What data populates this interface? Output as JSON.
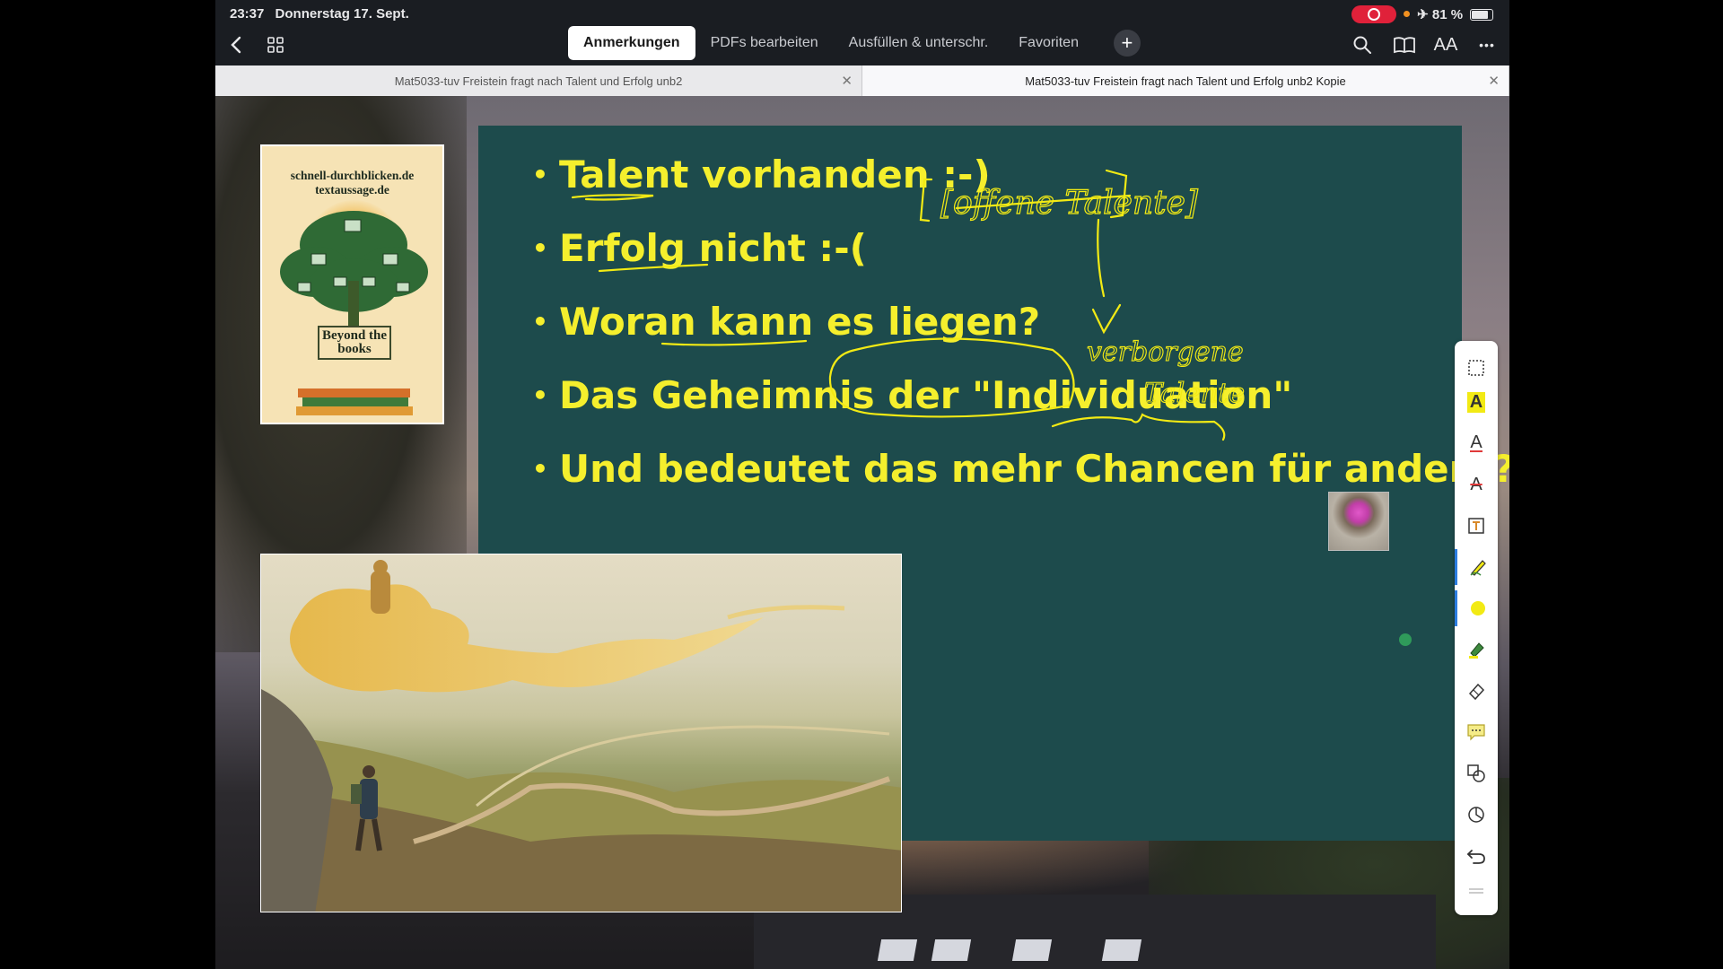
{
  "status": {
    "time": "23:37",
    "date": "Donnerstag 17. Sept.",
    "battery": "81 %",
    "battery_level": 0.81
  },
  "toolbar": {
    "back_icon": "chevron-left-icon",
    "grid_icon": "grid-icon",
    "tabs": [
      {
        "label": "Anmerkungen",
        "active": true
      },
      {
        "label": "PDFs bearbeiten",
        "active": false
      },
      {
        "label": "Ausfüllen & unterschr.",
        "active": false
      },
      {
        "label": "Favoriten",
        "active": false
      }
    ],
    "right_icons": [
      "search-icon",
      "book-icon",
      "text-size-icon",
      "more-icon"
    ],
    "text_size_label": "AA",
    "more_label": "•••"
  },
  "documents": [
    {
      "title": "Mat5033-tuv Freistein fragt nach Talent und Erfolg unb2",
      "active": false
    },
    {
      "title": "Mat5033-tuv Freistein fragt nach Talent und Erfolg unb2 Kopie",
      "active": true
    }
  ],
  "poster": {
    "line1": "schnell-durchblicken.de",
    "line2": "textaussage.de",
    "title": "Beyond the books"
  },
  "slide": {
    "bullets": [
      "Talent vorhanden :-)",
      "Erfolg nicht :-(",
      "Woran kann es liegen?",
      "Das Geheimnis der \"Individuation\"",
      "Und bedeutet das mehr Chancen für andere?"
    ],
    "handwriting": {
      "top_right": "[offene Talente]",
      "right_line1": "verborgene",
      "right_line2": "Talente"
    },
    "ink_color": "#f5ef2d",
    "board_color": "#1d4b4c"
  },
  "palette": {
    "tools": [
      "lasso-select-icon",
      "highlight-text-icon",
      "underline-text-icon",
      "strikethrough-text-icon",
      "text-box-icon",
      "pen-icon",
      "color-dot-icon",
      "highlighter-icon",
      "eraser-icon",
      "comment-icon",
      "shapes-icon",
      "stamp-icon",
      "undo-icon",
      "handle-icon"
    ],
    "selected_color": "#f2ea14"
  }
}
